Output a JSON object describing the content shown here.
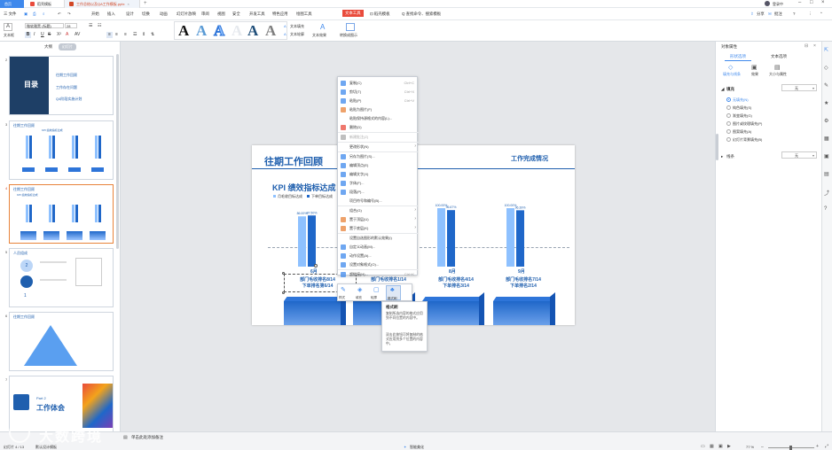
{
  "titlebar": {
    "home_tab": "首页",
    "tab1": "稻壳模板",
    "tab2": "工作总结以及QA工作模板.pptx",
    "right_status": "登录中"
  },
  "menubar": {
    "file": "三 文件",
    "items": [
      "开始",
      "插入",
      "设计",
      "切换",
      "动画",
      "幻灯片放映",
      "审阅",
      "视图",
      "安全",
      "开发工具",
      "特色应用",
      "绘图工具",
      "文本工具"
    ],
    "cloud": "⊡ 稻壳模板",
    "search": "Q 查找命令、搜索模板",
    "share": "分享",
    "annotate": "批注",
    "help": "?"
  },
  "toolbar": {
    "text_box": "文本框",
    "font_name": "微软雅黑 (标题)",
    "font_size": "28",
    "bold": "B",
    "italic": "I",
    "underline": "U",
    "strike": "S",
    "wordart": "A",
    "text_fill": "文本填充",
    "text_outline": "文本轮廓",
    "text_effect": "文本效果",
    "convert_art": "转换成图示"
  },
  "panel": {
    "tab_outline": "大纲",
    "tab_slides": "幻灯片",
    "slides": [
      {
        "num": "2",
        "title": "目录",
        "items": [
          "往期工作回顾",
          "工作存在问题",
          "Q4阶段实施计划"
        ]
      },
      {
        "num": "3",
        "title": "往期工作回顾",
        "chart_title": "KPI 绩效指标达成",
        "x": [
          "6月",
          "7月",
          "8月",
          "9月"
        ]
      },
      {
        "num": "4",
        "title": "往期工作回顾",
        "chart_title": "KPI 绩效指标达成"
      },
      {
        "num": "5",
        "title": "人员组成",
        "labels": [
          "2",
          "1"
        ]
      },
      {
        "num": "6",
        "title": "往期工作回顾"
      },
      {
        "num": "7",
        "part": "Part 2",
        "title": "工作体会"
      }
    ]
  },
  "slide": {
    "title": "往期工作回顾",
    "corner_title": "工作完成情况",
    "chart_title": "KPI 绩效指标达成",
    "legend": [
      "月毛收目标达成",
      "下单目标达成"
    ],
    "x_labels": [
      "6月",
      "8月",
      "9月"
    ],
    "bar_labels": [
      "86.00%",
      "87.50%",
      "90.00%",
      "100.00%",
      "96.67%",
      "95.00%",
      "100.00%",
      "96.39%"
    ],
    "footer_left": "部门毛收排名8/14\n下单排名第6/14",
    "footer_mid": "部门毛收排名1/14",
    "footer_c": "部门毛收排名4/14\n下单排名3/14",
    "footer_d": "部门毛收排名7/14\n下单排名2/14"
  },
  "chart_data": {
    "type": "bar",
    "title": "KPI 绩效指标达成",
    "categories": [
      "6月",
      "8月",
      "9月"
    ],
    "series": [
      {
        "name": "月毛收目标达成",
        "values": [
          86,
          100,
          100
        ]
      },
      {
        "name": "下单目标达成",
        "values": [
          87.5,
          96.67,
          96.39
        ]
      }
    ],
    "ylim": [
      0,
      100
    ]
  },
  "context_menu": {
    "items": [
      {
        "label": "复制(C)",
        "shortcut": "Ctrl+C"
      },
      {
        "label": "剪切(T)",
        "shortcut": "Ctrl+X"
      },
      {
        "label": "粘贴(P)",
        "shortcut": "Ctrl+V"
      },
      {
        "label": "粘贴为图片(F)",
        "shortcut": ""
      },
      {
        "label": "粘贴保持源格式的内容(L)...",
        "shortcut": ""
      },
      {
        "label": "删除(D)",
        "shortcut": ""
      },
      {
        "label": "新建批注(Z)",
        "shortcut": ""
      },
      {
        "label": "更改形状(N)",
        "shortcut": ""
      },
      {
        "label": "另存为图片(S)...",
        "shortcut": ""
      },
      {
        "label": "编辑顶点(E)",
        "shortcut": ""
      },
      {
        "label": "编辑文字(X)",
        "shortcut": ""
      },
      {
        "label": "字体(F)...",
        "shortcut": ""
      },
      {
        "label": "段落(P)...",
        "shortcut": ""
      },
      {
        "label": "项目符号和编号(B)...",
        "shortcut": ""
      },
      {
        "label": "组合(G)",
        "shortcut": ""
      },
      {
        "label": "置于顶层(U)",
        "shortcut": ""
      },
      {
        "label": "置于底层(K)",
        "shortcut": ""
      },
      {
        "label": "设置自选图形的默认效果(I)",
        "shortcut": ""
      },
      {
        "label": "自定义动画(M)...",
        "shortcut": ""
      },
      {
        "label": "动作设置(A)...",
        "shortcut": ""
      },
      {
        "label": "设置对象格式(O)...",
        "shortcut": ""
      },
      {
        "label": "超链接(H)...",
        "shortcut": "Ctrl+K"
      }
    ]
  },
  "mini_toolbar": {
    "style": "样式",
    "fill": "填充",
    "outline": "轮廓",
    "painter": "格式刷"
  },
  "tooltip": {
    "title": "格式刷",
    "body": "复制所选内容的格式应用到不同位置的内容中。",
    "body2": "双击此按钮可将复制的格式应用到多个位置的内容中。"
  },
  "right_panel": {
    "title": "对象属性",
    "tab_shape": "形状选项",
    "tab_text": "文本选项",
    "sub_fill_line": "填充与线条",
    "sub_effect": "效果",
    "sub_size": "大小与属性",
    "fill_section": "填充",
    "fill_value": "无",
    "options": [
      "无填充(N)",
      "纯色填充(S)",
      "渐变填充(G)",
      "图片或纹理填充(P)",
      "图案填充(A)",
      "幻灯片背景填充(B)"
    ],
    "line_section": "线条",
    "line_value": "无"
  },
  "status": {
    "slide_info": "幻灯片 4 / 13",
    "theme": "默认设计模板",
    "notes": "单击此处添加备注",
    "smart": "智能美化",
    "zoom": "77 %",
    "watermark": "大数跨境"
  },
  "colors": {
    "accent": "#3f89ec",
    "chart_dark": "#1f67c9",
    "chart_light": "#8ec1ff",
    "title_blue": "#1f5fae"
  }
}
